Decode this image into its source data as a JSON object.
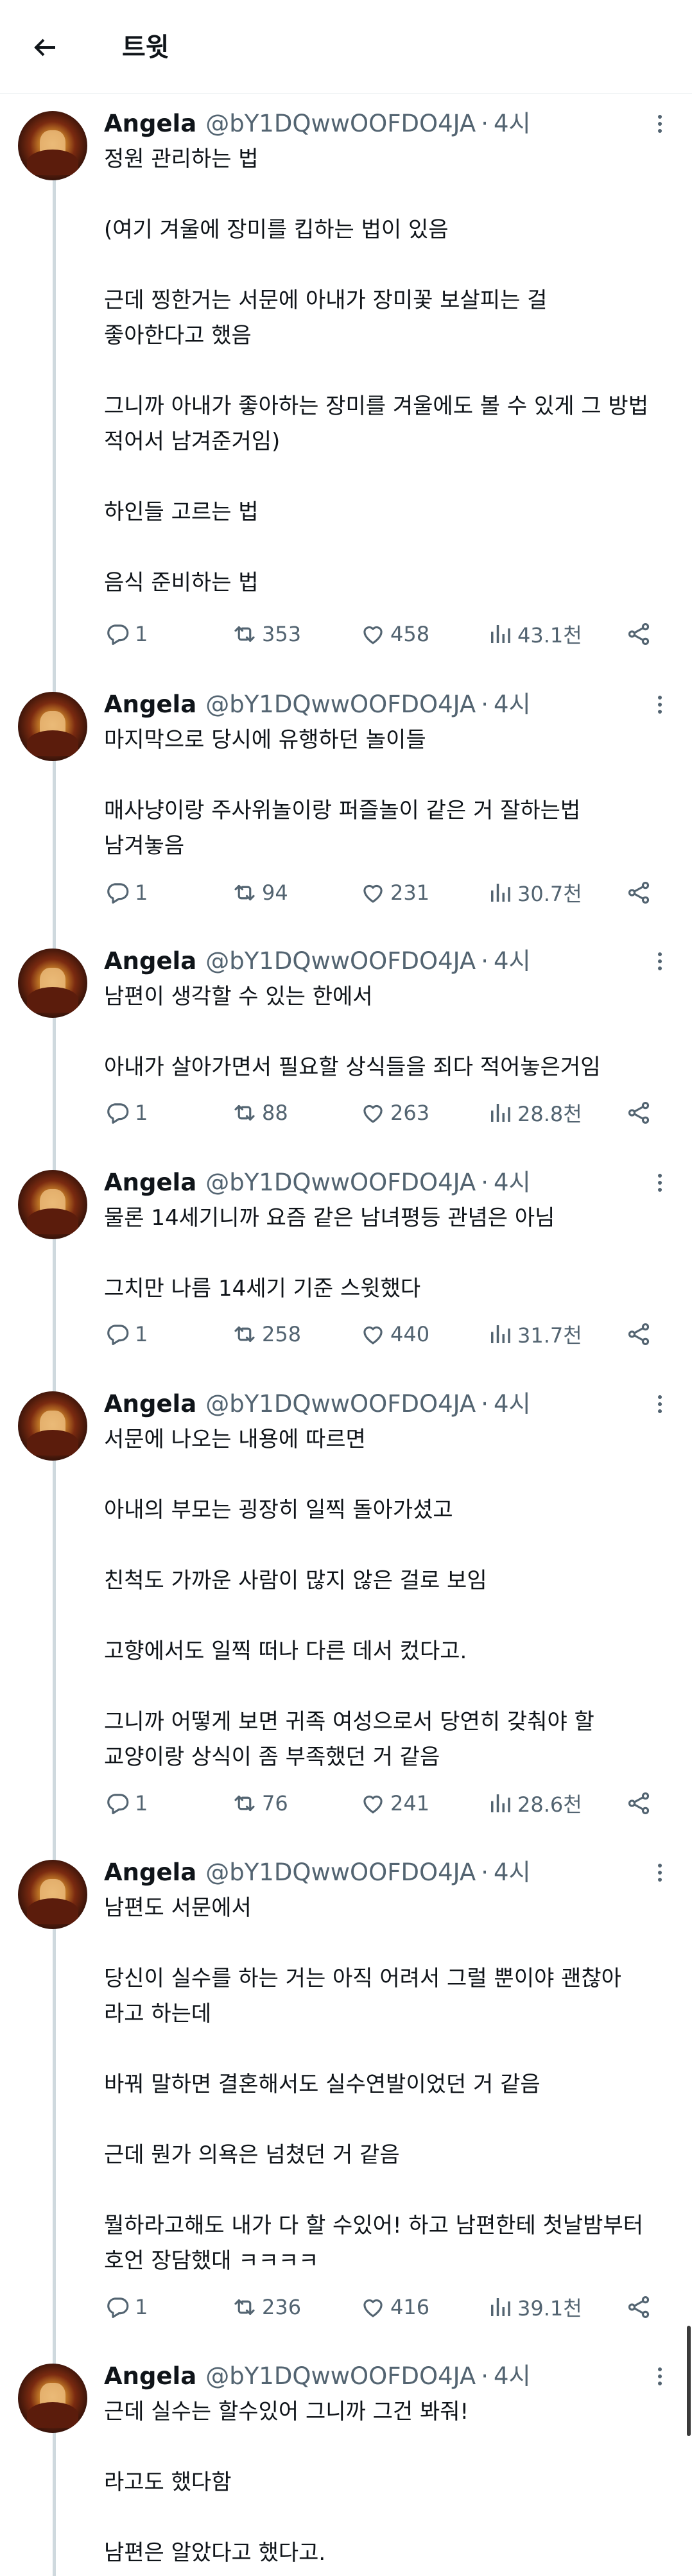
{
  "header": {
    "title": "트윗"
  },
  "tweets": [
    {
      "author": "Angela",
      "handle": "@bY1DQwwOOFDO4JA",
      "time": "4시",
      "paragraphs": [
        [
          "정원 관리하는 법"
        ],
        [
          "(여기 겨울에 장미를 킵하는 법이 있음"
        ],
        [
          "근데 찡한거는 서문에 아내가 장미꽃 보살피는 걸",
          "좋아한다고 했음"
        ],
        [
          "그니까 아내가 좋아하는 장미를 겨울에도 볼 수 있게 그 방법",
          "적어서 남겨준거임)"
        ],
        [
          "하인들 고르는 법"
        ],
        [
          "음식 준비하는 법"
        ]
      ],
      "replies": "1",
      "retweets": "353",
      "likes": "458",
      "views": "43.1천"
    },
    {
      "author": "Angela",
      "handle": "@bY1DQwwOOFDO4JA",
      "time": "4시",
      "paragraphs": [
        [
          "마지막으로 당시에 유행하던 놀이들"
        ],
        [
          "매사냥이랑 주사위놀이랑 퍼즐놀이 같은 거 잘하는법",
          "남겨놓음"
        ]
      ],
      "replies": "1",
      "retweets": "94",
      "likes": "231",
      "views": "30.7천"
    },
    {
      "author": "Angela",
      "handle": "@bY1DQwwOOFDO4JA",
      "time": "4시",
      "paragraphs": [
        [
          "남편이 생각할 수 있는 한에서"
        ],
        [
          "아내가 살아가면서 필요할 상식들을 죄다 적어놓은거임"
        ]
      ],
      "replies": "1",
      "retweets": "88",
      "likes": "263",
      "views": "28.8천"
    },
    {
      "author": "Angela",
      "handle": "@bY1DQwwOOFDO4JA",
      "time": "4시",
      "paragraphs": [
        [
          "물론 14세기니까 요즘 같은 남녀평등 관념은 아님"
        ],
        [
          "그치만 나름 14세기 기준 스윗했다"
        ]
      ],
      "replies": "1",
      "retweets": "258",
      "likes": "440",
      "views": "31.7천"
    },
    {
      "author": "Angela",
      "handle": "@bY1DQwwOOFDO4JA",
      "time": "4시",
      "paragraphs": [
        [
          "서문에 나오는 내용에 따르면"
        ],
        [
          "아내의 부모는 굉장히 일찍 돌아가셨고"
        ],
        [
          "친척도 가까운 사람이 많지 않은 걸로 보임"
        ],
        [
          "고향에서도 일찍 떠나 다른 데서 컸다고."
        ],
        [
          "그니까 어떻게 보면 귀족 여성으로서 당연히 갖춰야 할",
          "교양이랑 상식이 좀 부족했던 거 같음"
        ]
      ],
      "replies": "1",
      "retweets": "76",
      "likes": "241",
      "views": "28.6천"
    },
    {
      "author": "Angela",
      "handle": "@bY1DQwwOOFDO4JA",
      "time": "4시",
      "paragraphs": [
        [
          "남편도 서문에서"
        ],
        [
          "당신이 실수를 하는 거는 아직 어려서 그럴 뿐이야 괜찮아",
          "라고 하는데"
        ],
        [
          "바꿔 말하면 결혼해서도 실수연발이었던 거 같음"
        ],
        [
          "근데 뭔가 의욕은 넘쳤던 거 같음"
        ],
        [
          "뭘하라고해도 내가 다 할 수있어! 하고 남편한테 첫날밤부터",
          "호언 장담했대 ㅋㅋㅋㅋ"
        ]
      ],
      "replies": "1",
      "retweets": "236",
      "likes": "416",
      "views": "39.1천"
    },
    {
      "author": "Angela",
      "handle": "@bY1DQwwOOFDO4JA",
      "time": "4시",
      "paragraphs": [
        [
          "근데 실수는 할수있어 그니까 그건 봐줘!"
        ],
        [
          "라고도 했다함"
        ],
        [
          "남편은 알았다고 했다고."
        ]
      ]
    }
  ]
}
